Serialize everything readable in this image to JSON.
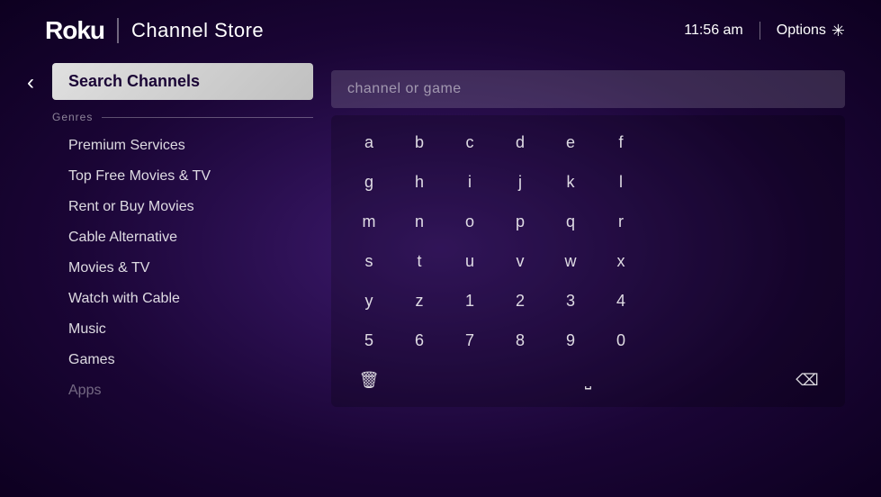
{
  "header": {
    "logo": "Roku",
    "title": "Channel Store",
    "time": "11:56 am",
    "options_label": "Options"
  },
  "sidebar": {
    "search_channels_label": "Search Channels",
    "genres_label": "Genres",
    "items": [
      {
        "label": "Premium Services",
        "dimmed": false
      },
      {
        "label": "Top Free Movies & TV",
        "dimmed": false
      },
      {
        "label": "Rent or Buy Movies",
        "dimmed": false
      },
      {
        "label": "Cable Alternative",
        "dimmed": false
      },
      {
        "label": "Movies & TV",
        "dimmed": false
      },
      {
        "label": "Watch with Cable",
        "dimmed": false
      },
      {
        "label": "Music",
        "dimmed": false
      },
      {
        "label": "Games",
        "dimmed": false
      },
      {
        "label": "Apps",
        "dimmed": true
      }
    ]
  },
  "keyboard": {
    "placeholder": "channel or game",
    "rows": [
      [
        "a",
        "b",
        "c",
        "d",
        "e",
        "f"
      ],
      [
        "g",
        "h",
        "i",
        "j",
        "k",
        "l"
      ],
      [
        "m",
        "n",
        "o",
        "p",
        "q",
        "r"
      ],
      [
        "s",
        "t",
        "u",
        "v",
        "w",
        "x"
      ],
      [
        "y",
        "z",
        "1",
        "2",
        "3",
        "4"
      ],
      [
        "5",
        "6",
        "7",
        "8",
        "9",
        "0"
      ]
    ],
    "special_row": {
      "delete_icon": "🗑",
      "space_icon": "⌴",
      "backspace_icon": "⌫"
    }
  },
  "back_label": "‹"
}
